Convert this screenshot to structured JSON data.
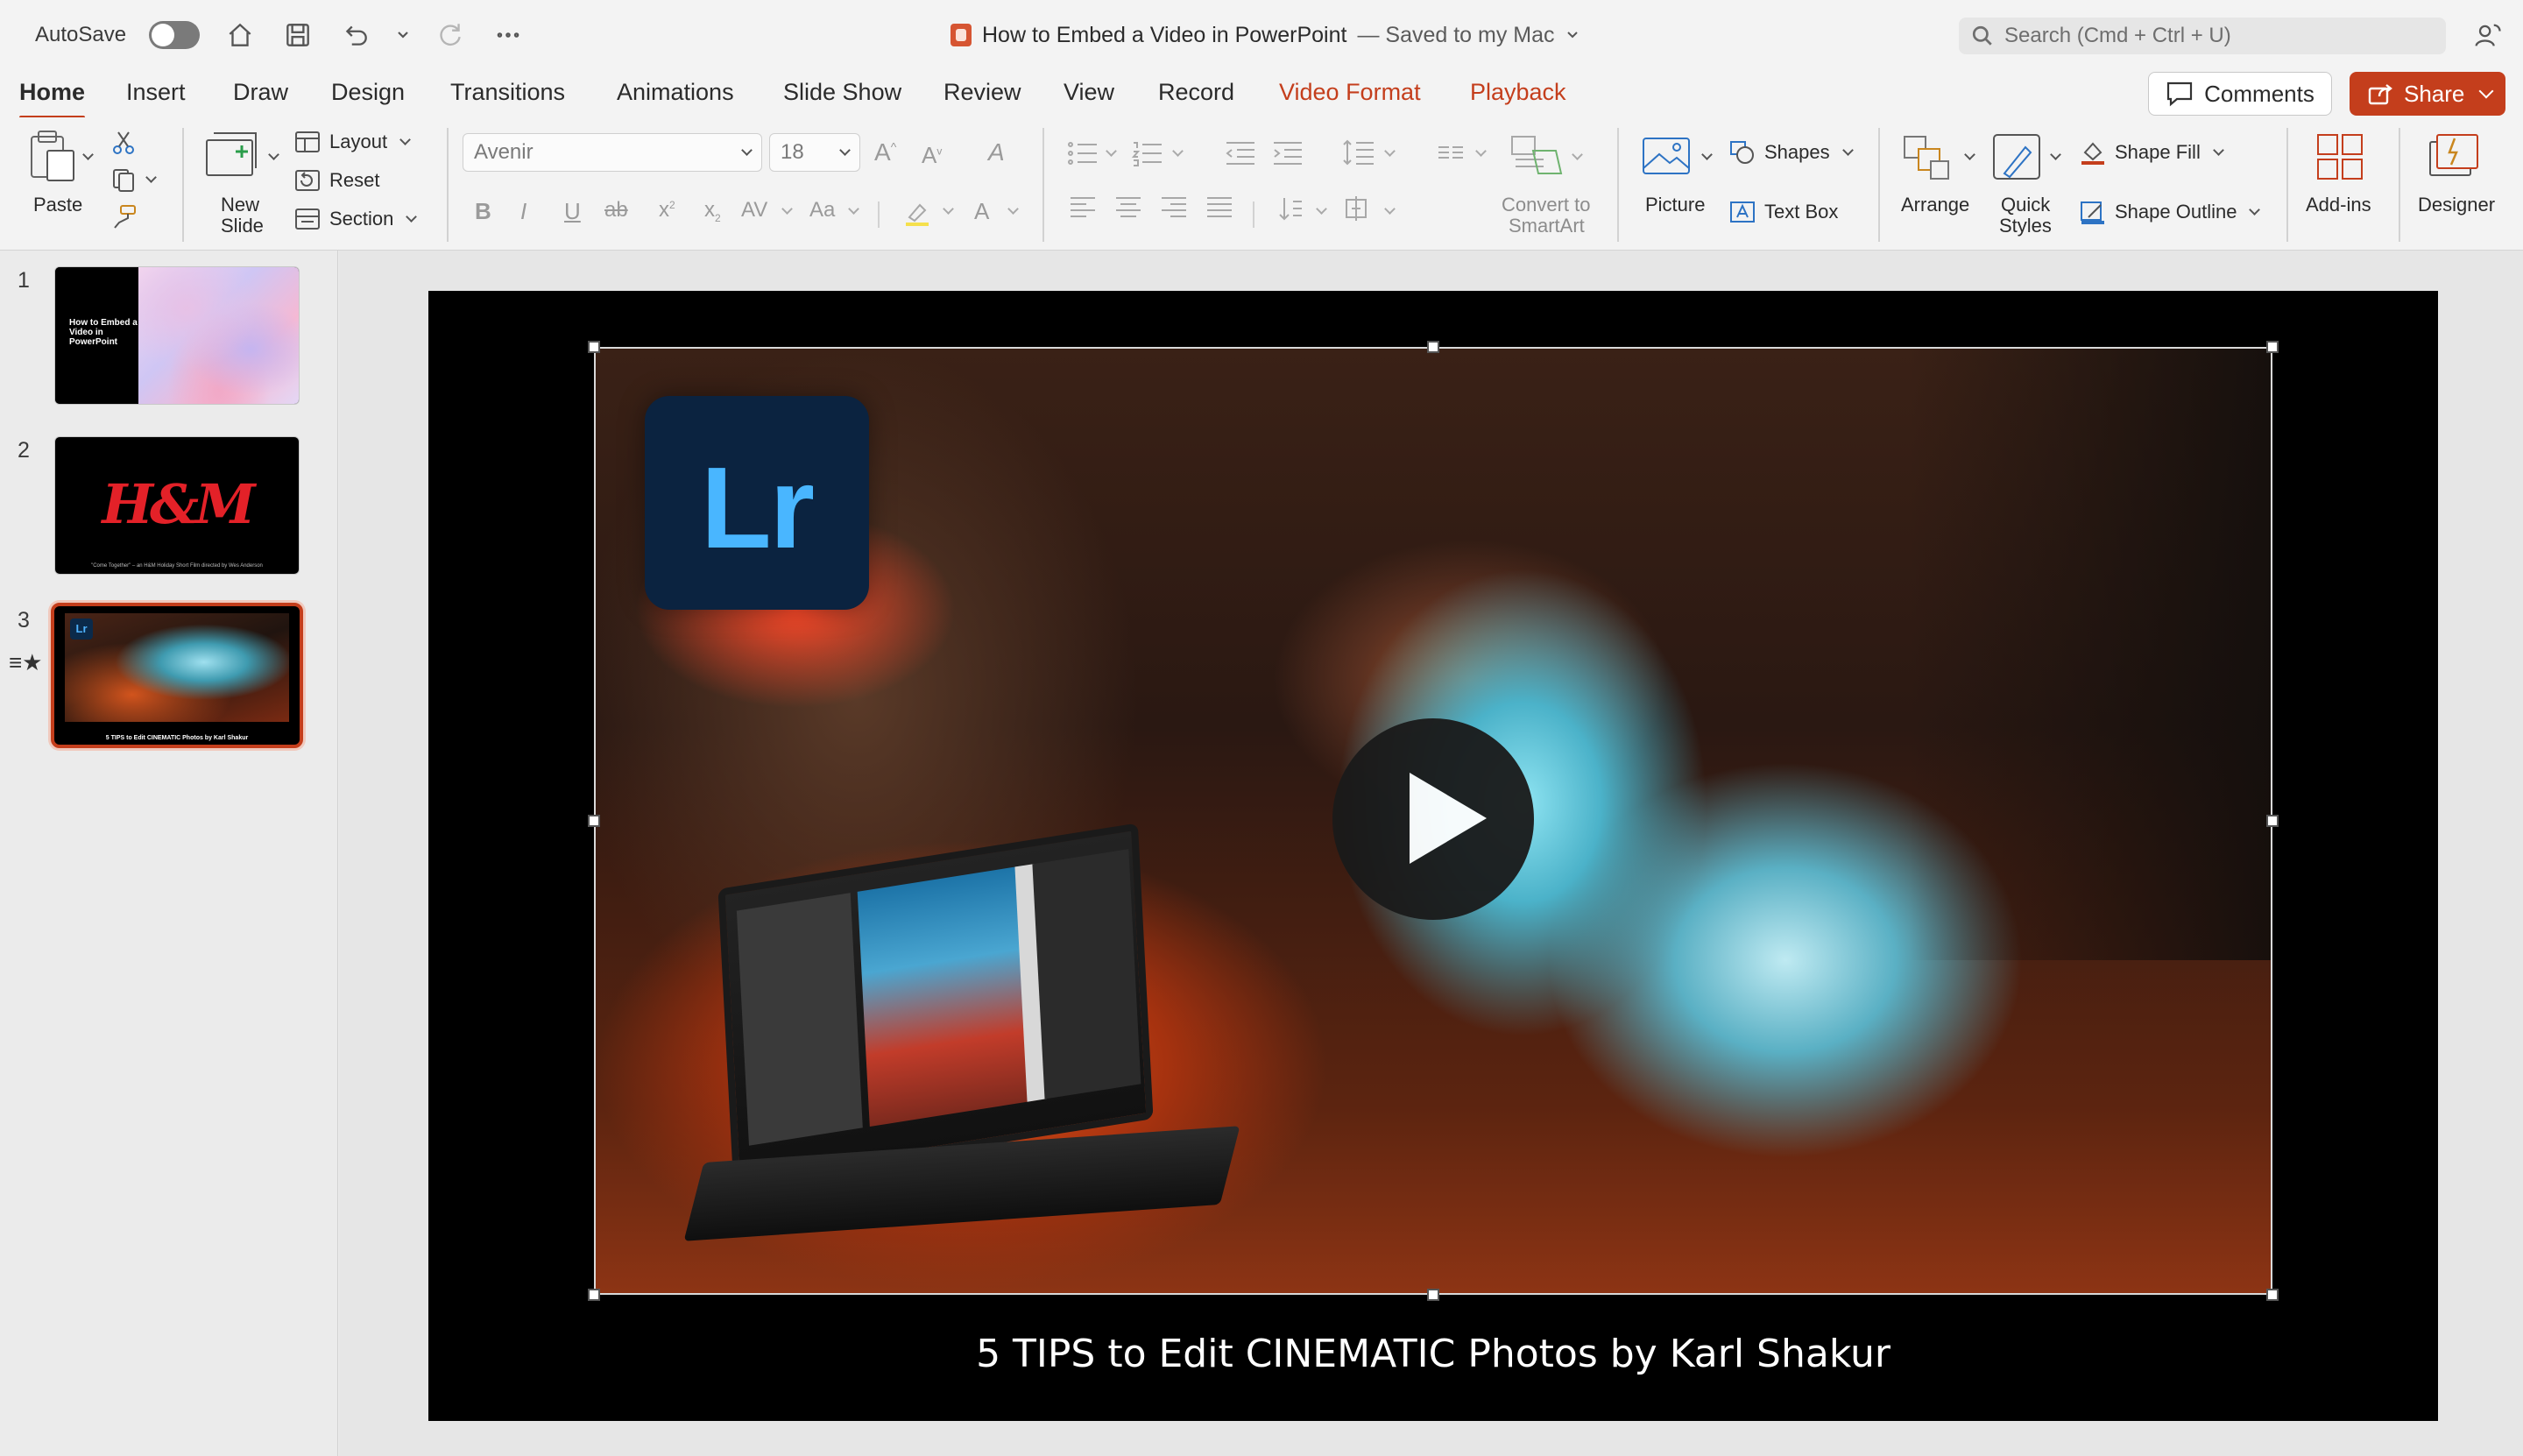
{
  "titlebar": {
    "autosave_label": "AutoSave",
    "doc_title": "How to Embed a Video in PowerPoint",
    "doc_status": "— Saved to my Mac",
    "search_placeholder": "Search (Cmd + Ctrl + U)"
  },
  "tabs": [
    {
      "label": "Home",
      "active": true
    },
    {
      "label": "Insert"
    },
    {
      "label": "Draw"
    },
    {
      "label": "Design"
    },
    {
      "label": "Transitions"
    },
    {
      "label": "Animations"
    },
    {
      "label": "Slide Show"
    },
    {
      "label": "Review"
    },
    {
      "label": "View"
    },
    {
      "label": "Record"
    },
    {
      "label": "Video Format",
      "contextual": true
    },
    {
      "label": "Playback",
      "contextual": true
    }
  ],
  "actions": {
    "comments": "Comments",
    "share": "Share"
  },
  "ribbon": {
    "paste": "Paste",
    "new_slide_line1": "New",
    "new_slide_line2": "Slide",
    "layout": "Layout",
    "reset": "Reset",
    "section": "Section",
    "font_name": "Avenir",
    "font_size": "18",
    "convert_line1": "Convert to",
    "convert_line2": "SmartArt",
    "picture": "Picture",
    "shapes": "Shapes",
    "text_box": "Text Box",
    "arrange": "Arrange",
    "quick_styles_line1": "Quick",
    "quick_styles_line2": "Styles",
    "shape_fill": "Shape Fill",
    "shape_outline": "Shape Outline",
    "add_ins": "Add-ins",
    "designer": "Designer"
  },
  "slides": [
    {
      "num": "1",
      "thumb_text": "How to Embed a Video in PowerPoint"
    },
    {
      "num": "2",
      "logo": "H&M",
      "caption": "\"Come Together\" – an H&M Holiday Short Film directed by Wes Anderson"
    },
    {
      "num": "3",
      "lr": "Lr",
      "caption": "5 TIPS to Edit CINEMATIC Photos by Karl Shakur",
      "selected": true
    }
  ],
  "slide": {
    "video_logo": "Lr",
    "caption": "5 TIPS to Edit CINEMATIC Photos by Karl Shakur"
  },
  "colors": {
    "accent": "#c43e1c",
    "lr_blue": "#49b6ff",
    "hm_red": "#e32128"
  }
}
